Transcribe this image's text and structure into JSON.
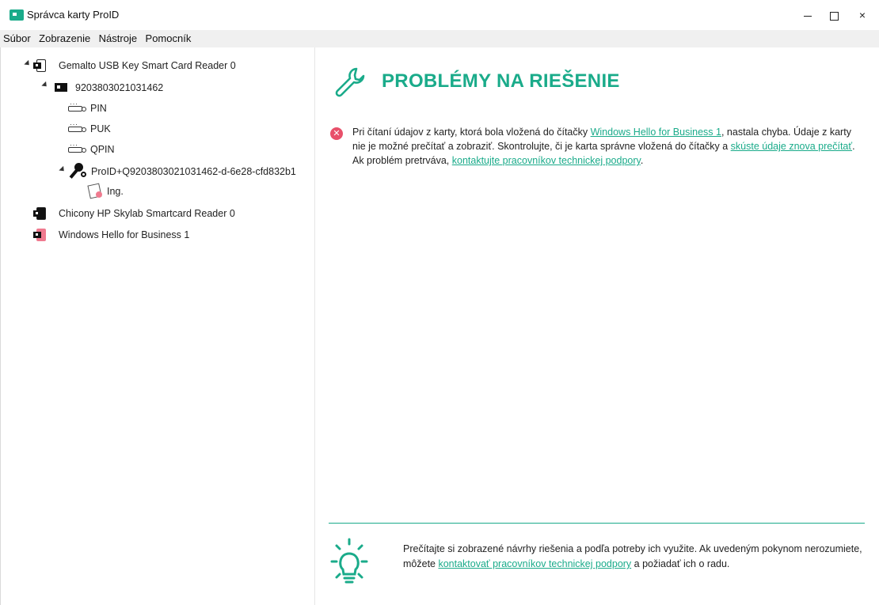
{
  "window": {
    "title": "Správca karty ProID",
    "controls": {
      "minimize": "minimize",
      "maximize": "maximize",
      "close": "×"
    }
  },
  "menu": [
    "Súbor",
    "Zobrazenie",
    "Nástroje",
    "Pomocník"
  ],
  "tree": {
    "reader1": "Gemalto USB Key Smart Card Reader 0",
    "card": "9203803021031462",
    "pin": "PIN",
    "puk": "PUK",
    "qpin": "QPIN",
    "key": "ProID+Q9203803021031462-d-6e28-cfd832b1",
    "cert": "Ing.",
    "reader2": "Chicony HP Skylab Smartcard Reader 0",
    "reader3": "Windows Hello for Business 1"
  },
  "main": {
    "heading": "PROBLÉMY NA RIEŠENIE",
    "error": {
      "t1": "Pri čítaní údajov z karty, ktorá bola vložená do čítačky ",
      "link1": "Windows Hello for Business 1",
      "t2": ", nastala chyba. Údaje z karty nie je možné prečítať a zobraziť. Skontrolujte, či je karta správne vložená do čítačky a ",
      "link2": "skúste údaje znova prečítať",
      "t3": ". Ak problém pretrváva, ",
      "link3": "kontaktujte pracovníkov technickej podpory",
      "t4": "."
    },
    "tip": {
      "t1": "Prečítajte si zobrazené návrhy riešenia a podľa potreby ich využite. Ak uvedeným pokynom nerozumiete, môžete ",
      "link": "kontaktovať pracovníkov technickej podpory",
      "t2": " a požiadať ich o radu."
    }
  },
  "colors": {
    "accent": "#1aab8a",
    "error": "#e8506a",
    "pink": "#f07a8f"
  }
}
